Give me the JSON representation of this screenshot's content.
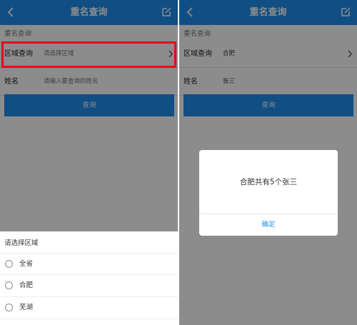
{
  "left": {
    "header": {
      "title": "重名查询"
    },
    "section_label": "重名查询",
    "region": {
      "label": "区域查询",
      "value": "请选择区域"
    },
    "name": {
      "label": "姓名",
      "placeholder": "请输入要查询的姓名"
    },
    "query_button": "查询",
    "picker": {
      "title": "请选择区域",
      "options": [
        "全省",
        "合肥",
        "芜湖",
        ""
      ]
    }
  },
  "right": {
    "header": {
      "title": "重名查询"
    },
    "section_label": "重名查询",
    "region": {
      "label": "区域查询",
      "value": "合肥"
    },
    "name": {
      "label": "姓名",
      "value": "张三"
    },
    "query_button": "查询",
    "dialog": {
      "message": "合肥共有5个张三",
      "ok_label": "确定"
    }
  },
  "colors": {
    "primary": "#1f8ef0",
    "highlight": "#e8001c"
  }
}
